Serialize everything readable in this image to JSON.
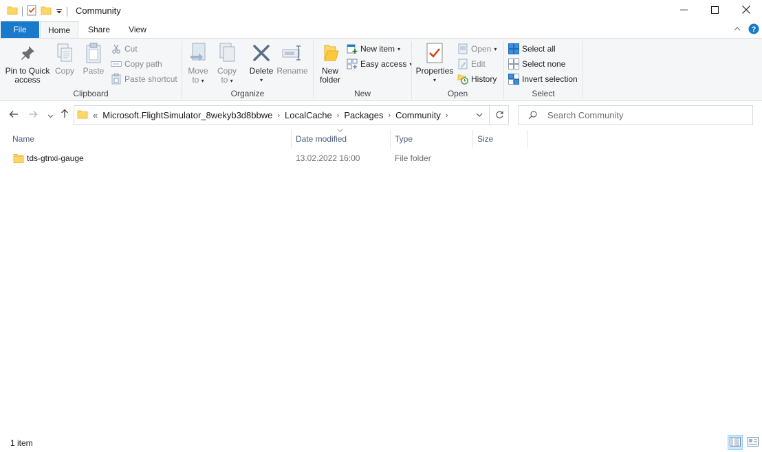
{
  "window": {
    "title": "Community",
    "minimize_icon": "minimize-icon",
    "maximize_icon": "maximize-icon",
    "close_icon": "close-icon"
  },
  "tabs": [
    {
      "label": "File"
    },
    {
      "label": "Home"
    },
    {
      "label": "Share"
    },
    {
      "label": "View"
    }
  ],
  "ribbon": {
    "clipboard": {
      "label": "Clipboard",
      "pin_line1": "Pin to Quick",
      "pin_line2": "access",
      "copy": "Copy",
      "paste": "Paste",
      "cut": "Cut",
      "copy_path": "Copy path",
      "paste_shortcut": "Paste shortcut"
    },
    "organize": {
      "label": "Organize",
      "move_line1": "Move",
      "move_line2": "to",
      "copy_line1": "Copy",
      "copy_line2": "to",
      "delete": "Delete",
      "rename": "Rename"
    },
    "new": {
      "label": "New",
      "folder_line1": "New",
      "folder_line2": "folder",
      "new_item": "New item",
      "easy_access": "Easy access"
    },
    "open": {
      "label": "Open",
      "properties": "Properties",
      "open": "Open",
      "edit": "Edit",
      "history": "History"
    },
    "select": {
      "label": "Select",
      "select_all": "Select all",
      "select_none": "Select none",
      "invert": "Invert selection"
    }
  },
  "address": {
    "overflow": "«",
    "crumbs": [
      "Microsoft.FlightSimulator_8wekyb3d8bbwe",
      "LocalCache",
      "Packages",
      "Community"
    ]
  },
  "search": {
    "placeholder": "Search Community"
  },
  "columns": {
    "name": "Name",
    "date": "Date modified",
    "type": "Type",
    "size": "Size"
  },
  "files": [
    {
      "name": "tds-gtnxi-gauge",
      "date": "13.02.2022 16:00",
      "type": "File folder",
      "size": ""
    }
  ],
  "status": {
    "count": "1 item"
  },
  "colors": {
    "accent": "#1979ca",
    "folder": "#ffd766",
    "folder_dark": "#e8b93e"
  }
}
